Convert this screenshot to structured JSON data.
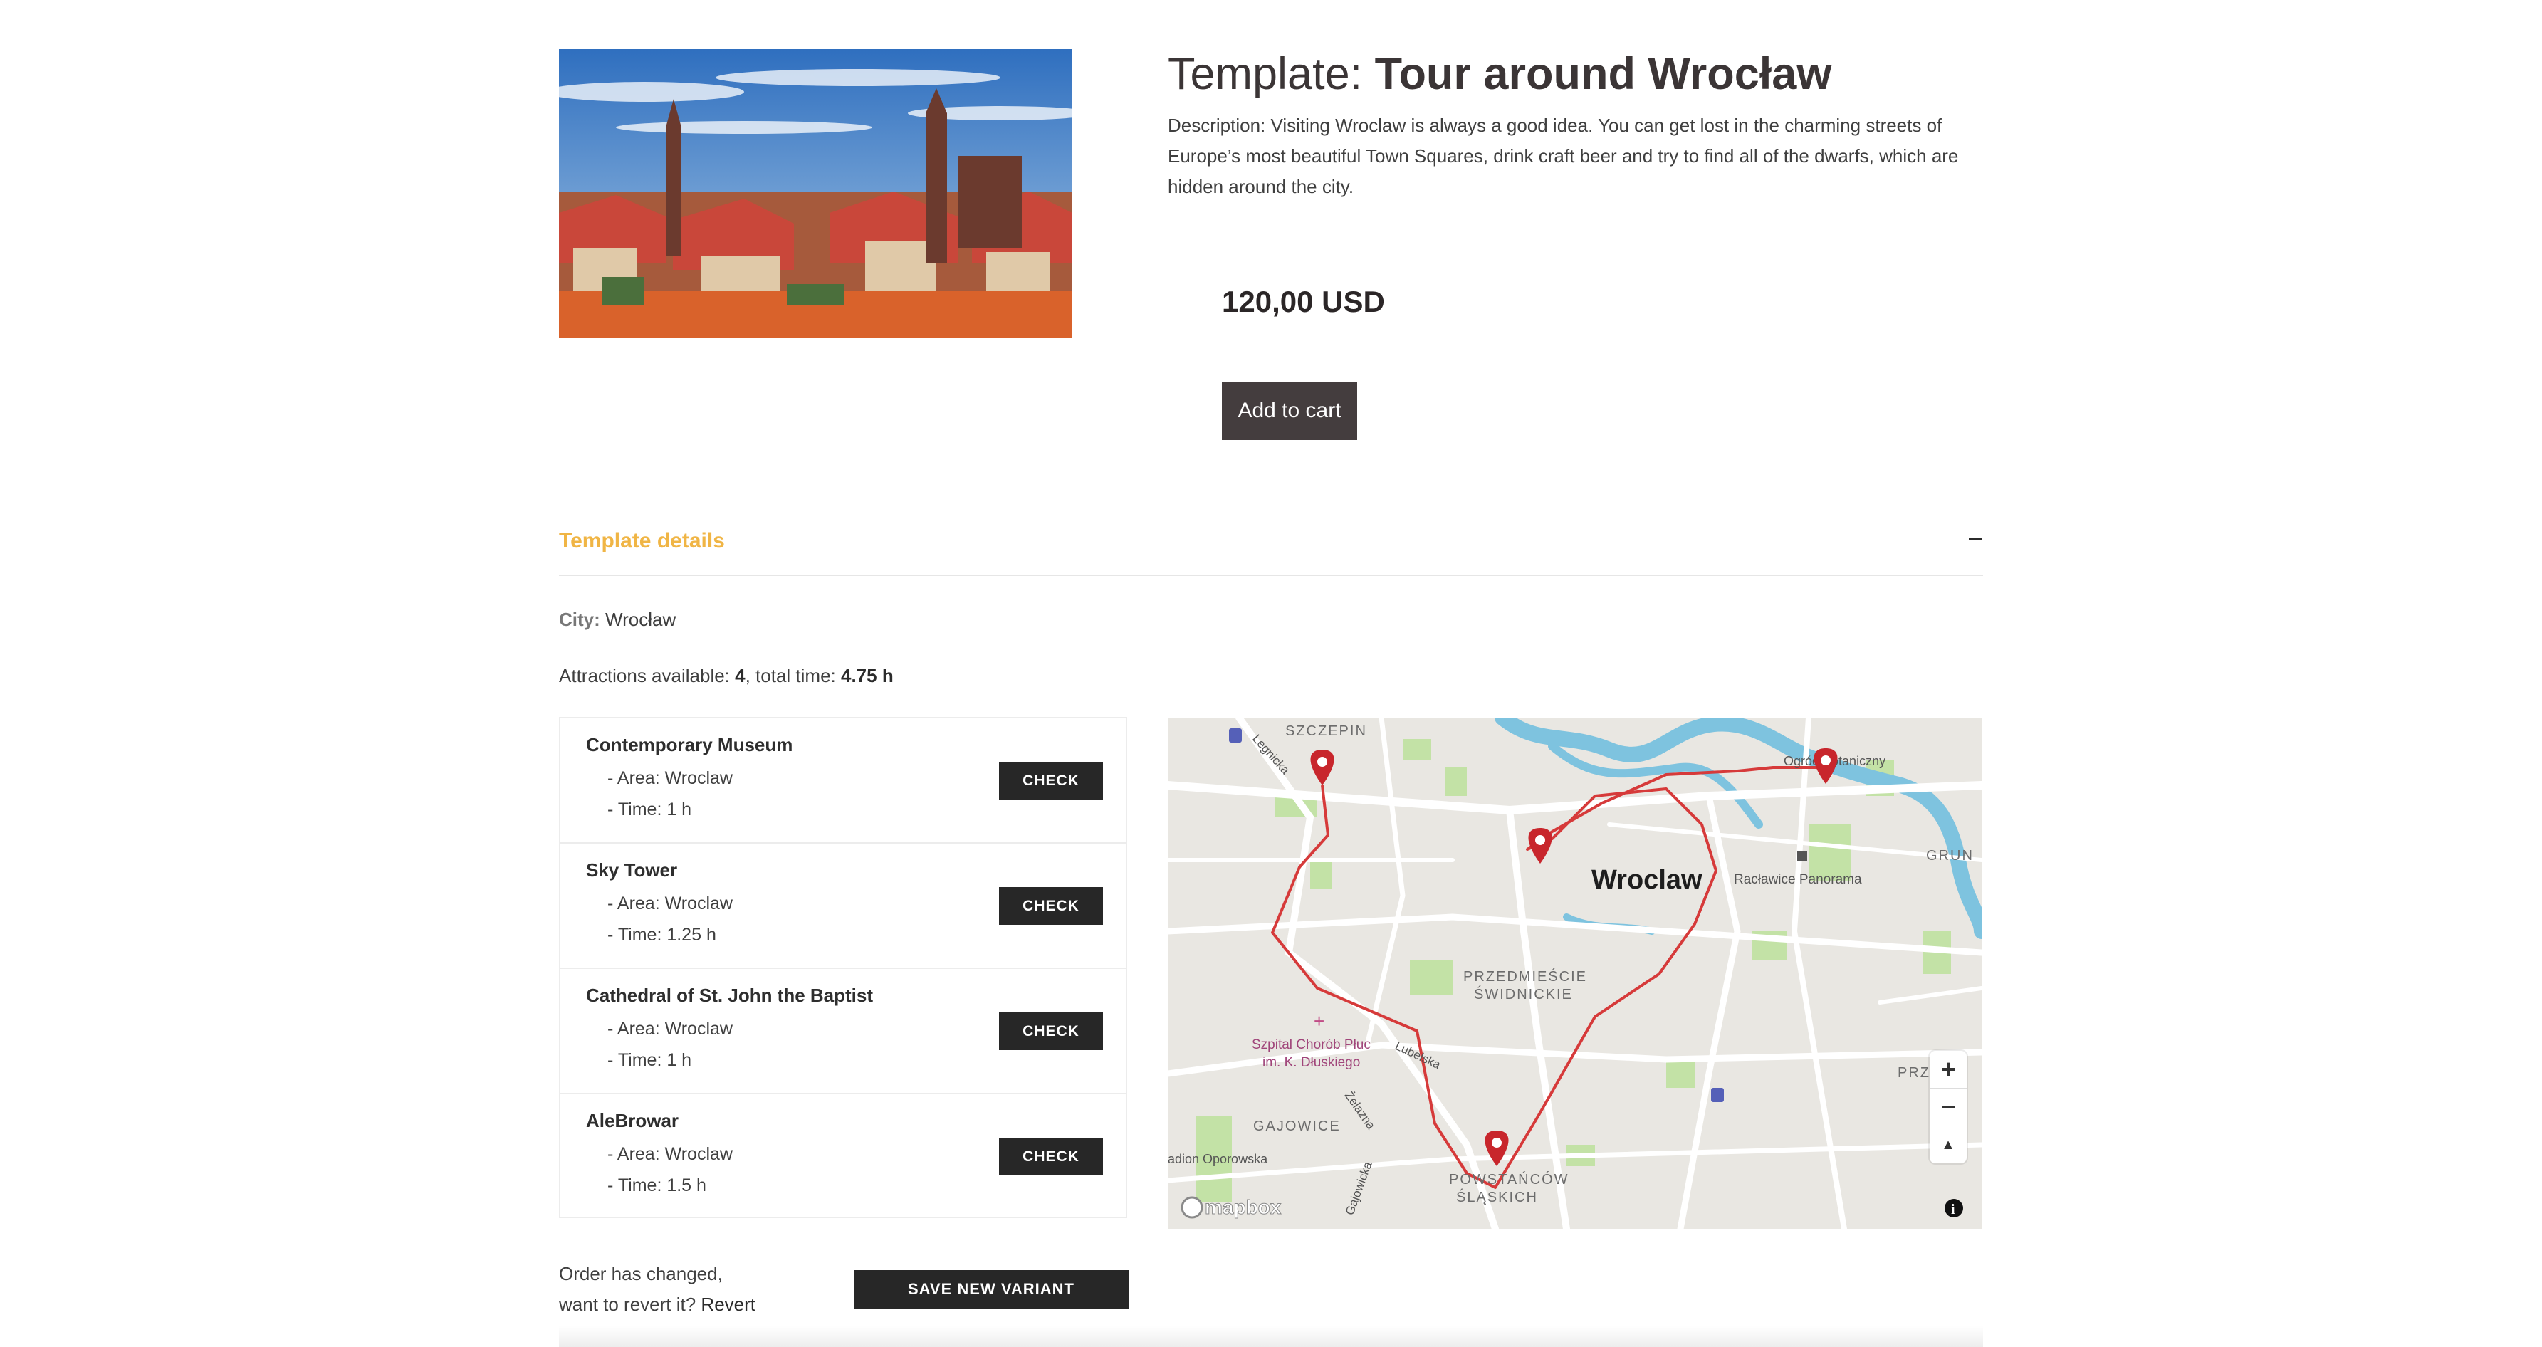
{
  "product": {
    "title_prefix": "Template: ",
    "title_name": "Tour around Wrocław",
    "description": "Description: Visiting Wroclaw is always a good idea. You can get lost in the charming streets of Europe’s most beautiful Town Squares, drink craft beer and try to find all of the dwarfs, which are hidden around the city.",
    "price": "120,00 USD",
    "add_to_cart_label": "Add to cart"
  },
  "details": {
    "section_title": "Template details",
    "city_label": "City:",
    "city_value": "Wrocław",
    "attractions_label": "Attractions available: ",
    "attractions_count": "4",
    "total_time_label": ", total time: ",
    "total_time": "4.75 h"
  },
  "attractions": [
    {
      "name": "Contemporary Museum",
      "area": "- Area: Wroclaw",
      "time": "- Time: 1 h",
      "button": "CHECK"
    },
    {
      "name": "Sky Tower",
      "area": "- Area: Wroclaw",
      "time": "- Time: 1.25 h",
      "button": "CHECK"
    },
    {
      "name": "Cathedral of St. John the Baptist",
      "area": "- Area: Wroclaw",
      "time": "- Time: 1 h",
      "button": "CHECK"
    },
    {
      "name": "AleBrowar",
      "area": "- Area: Wroclaw",
      "time": "- Time: 1.5 h",
      "button": "CHECK"
    }
  ],
  "map": {
    "city_label": "Wroclaw",
    "district_labels": [
      "SZCZEPIN",
      "PRZEDMIEŚCIE",
      "ŚWIDNICKIE",
      "GAJOWICE",
      "POWSTAŃCÓW",
      "ŚLĄSKICH",
      "GRUN",
      "PRZ"
    ],
    "poi_labels": [
      "Racławice Panorama",
      "Ogród Botaniczny",
      "Szpital Chorób Płuc",
      "im. K. Dłuskiego",
      "adion Oporowska"
    ],
    "street_labels": [
      "Legnicka",
      "Lubelska",
      "Żelazna",
      "Gajowicka"
    ],
    "attribution": "mapbox",
    "zoom_in": "+",
    "zoom_out": "−",
    "compass": "▲",
    "info": "i",
    "colors": {
      "route": "#d63a3a",
      "marker": "#c8262c",
      "water": "#7ec3df",
      "park": "#c3e2a6",
      "road": "#ffffff"
    }
  },
  "footer": {
    "order_changed_line1": "Order has changed,",
    "order_changed_line2": "want to revert it? ",
    "revert_label": "Revert",
    "save_variant_label": "SAVE NEW VARIANT"
  }
}
